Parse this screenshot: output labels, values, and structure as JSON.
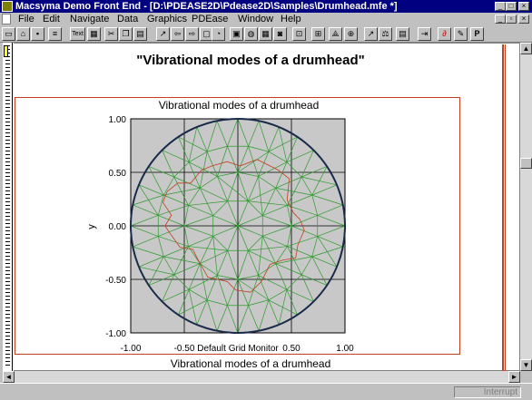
{
  "window": {
    "title": "Macsyma Demo Front End - [D:\\PDEASE2D\\Pdease2D\\Samples\\Drumhead.mfe *]"
  },
  "menu": {
    "items": [
      "File",
      "Edit",
      "Navigate",
      "Data",
      "Graphics",
      "PDEase",
      "Window",
      "Help"
    ]
  },
  "toolbar": {
    "text_button": "Text",
    "p_button": "P"
  },
  "document": {
    "heading": "\"Vibrational modes of a drumhead\"",
    "caption_below": "Vibrational modes of a drumhead"
  },
  "chart_data": {
    "type": "scatter",
    "title": "Vibrational modes of a drumhead",
    "xlabel": "Default Grid Monitor",
    "ylabel": "y",
    "xlim": [
      -1.0,
      1.0
    ],
    "ylim": [
      -1.0,
      1.0
    ],
    "x_ticks": [
      "-1.00",
      "-0.50",
      "0.50",
      "1.00"
    ],
    "y_ticks": [
      "1.00",
      "0.50",
      "0.00",
      "-0.50",
      "-1.00"
    ],
    "grid": true,
    "colors": {
      "background": "#c8c8c8",
      "mesh": "#2e9a2e",
      "contour": "#c04020",
      "boundary": "#1a2a4a"
    },
    "boundary": {
      "shape": "circle",
      "center": [
        0,
        0
      ],
      "radius": 1.0
    },
    "contour": [
      [
        -0.66,
        0.32
      ],
      [
        -0.7,
        0.22
      ],
      [
        -0.62,
        0.1
      ],
      [
        -0.68,
        0.0
      ],
      [
        -0.64,
        -0.06
      ],
      [
        -0.54,
        -0.2
      ],
      [
        -0.42,
        -0.22
      ],
      [
        -0.38,
        -0.3
      ],
      [
        -0.28,
        -0.48
      ],
      [
        -0.1,
        -0.52
      ],
      [
        -0.02,
        -0.6
      ],
      [
        0.12,
        -0.62
      ],
      [
        0.22,
        -0.52
      ],
      [
        0.3,
        -0.36
      ],
      [
        0.42,
        -0.32
      ],
      [
        0.54,
        -0.3
      ],
      [
        0.56,
        -0.18
      ],
      [
        0.62,
        -0.04
      ],
      [
        0.58,
        0.06
      ],
      [
        0.52,
        0.12
      ],
      [
        0.46,
        0.24
      ],
      [
        0.48,
        0.44
      ],
      [
        0.38,
        0.52
      ],
      [
        0.18,
        0.62
      ],
      [
        0.02,
        0.56
      ],
      [
        -0.1,
        0.6
      ],
      [
        -0.24,
        0.56
      ],
      [
        -0.34,
        0.52
      ],
      [
        -0.44,
        0.4
      ],
      [
        -0.56,
        0.4
      ],
      [
        -0.66,
        0.32
      ]
    ]
  },
  "status": {
    "interrupt": "Interrupt"
  }
}
